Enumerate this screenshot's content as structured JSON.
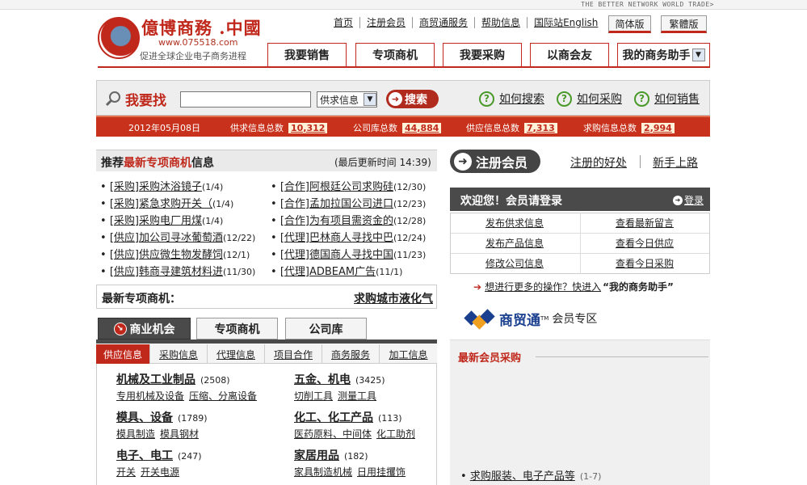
{
  "header": {
    "tagline_top": "THE BETTER NETWORK WORLD TRADE>",
    "logo_title": "億博商務 .中國",
    "logo_url": "www.075518.com",
    "logo_slogan": "促进全球企业电子商务进程",
    "top_links": [
      "首页",
      "注册会员",
      "商贸通服务",
      "帮助信息",
      "国际站English"
    ],
    "lang_simplified": "简体版",
    "lang_traditional": "繁體版",
    "main_tabs": [
      "我要销售",
      "专项商机",
      "我要采购",
      "以商会友"
    ],
    "assistant_select": "我的商务助手"
  },
  "search": {
    "title": "我要找",
    "input_value": "",
    "type_select": "供求信息",
    "button": "搜索",
    "howto": [
      "如何搜索",
      "如何采购",
      "如何销售"
    ]
  },
  "stats": {
    "date": "2012年05月08日",
    "items": [
      {
        "label": "供求信息总数",
        "value": "10,312"
      },
      {
        "label": "公司库总数",
        "value": "44,884"
      },
      {
        "label": "供应信息总数",
        "value": "7,313"
      },
      {
        "label": "求购信息总数",
        "value": "2,994"
      }
    ]
  },
  "recommended": {
    "title_pre": "推荐",
    "title_red": "最新专项商机",
    "title_post": "信息",
    "update": "(最后更新时间 14:39)",
    "left_items": [
      {
        "text": "[采购]采购沐浴镜子",
        "count": "(1/4)"
      },
      {
        "text": "[采购]紧急求购开关（",
        "count": "(1/4)"
      },
      {
        "text": "[采购]采购电厂用煤",
        "count": "(1/4)"
      },
      {
        "text": "[供应]加公司寻冰葡萄酒",
        "count": "(12/22)"
      },
      {
        "text": "[供应]供应微生物发酵饲",
        "count": "(12/1)"
      },
      {
        "text": "[供应]韩商寻建筑材料进",
        "count": "(11/30)"
      }
    ],
    "right_items": [
      {
        "text": "[合作]阿根廷公司求购硅",
        "count": "(12/30)"
      },
      {
        "text": "[合作]孟加拉国公司进口",
        "count": "(12/23)"
      },
      {
        "text": "[合作]为有项目需资金的",
        "count": "(12/28)"
      },
      {
        "text": "[代理]巴林商人寻找中巴",
        "count": "(12/24)"
      },
      {
        "text": "[代理]德国商人寻找中国",
        "count": "(11/23)"
      },
      {
        "text": "[代理]ADBEAM广告",
        "count": "(11/1)"
      }
    ]
  },
  "latest": {
    "label": "最新专项商机：",
    "scroll_text": "求购城市液化气"
  },
  "business": {
    "tabs": [
      "商业机会",
      "专项商机",
      "公司库"
    ],
    "subtabs": [
      "供应信息",
      "采购信息",
      "代理信息",
      "项目合作",
      "商务服务",
      "加工信息"
    ],
    "categories": [
      {
        "title": "机械及工业制品",
        "count": "(2508)",
        "subs": [
          "专用机械及设备",
          "压缩、分离设备"
        ]
      },
      {
        "title": "五金、机电",
        "count": "(3425)",
        "subs": [
          "切削工具",
          "测量工具"
        ]
      },
      {
        "title": "模具、设备",
        "count": "(1789)",
        "subs": [
          "模具制造",
          "模具钢材"
        ]
      },
      {
        "title": "化工、化工产品",
        "count": "(113)",
        "subs": [
          "医药原料、中间体",
          "化工助剂"
        ]
      },
      {
        "title": "电子、电工",
        "count": "(247)",
        "subs": [
          "开关",
          "开关电源"
        ]
      },
      {
        "title": "家居用品",
        "count": "(182)",
        "subs": [
          "家具制造机械",
          "日用挂攫饰"
        ]
      }
    ]
  },
  "member": {
    "register_button": "注册会员",
    "register_links": [
      "注册的好处",
      "新手上路"
    ],
    "welcome": "欢迎您！会员请登录",
    "login": "登录",
    "ops": [
      "发布供求信息",
      "查看最新留言",
      "发布产品信息",
      "查看今日供应",
      "修改公司信息",
      "查看今日采购"
    ],
    "more_ops_pre": "想进行更多的操作？快进入",
    "more_ops_strong": "“我的商务助手”"
  },
  "maotong": {
    "brand": "商贸通",
    "tm": "TM",
    "suffix": "会员专区",
    "section": "最新会员采购",
    "item": {
      "text": "求购服装、电子产品等",
      "count": "(1-7)"
    }
  },
  "colors": {
    "brand_red": "#c0281c",
    "dark_gray": "#4a4a4a",
    "accent_green": "#4a9a2a",
    "maotong_blue": "#1a3f8f"
  }
}
